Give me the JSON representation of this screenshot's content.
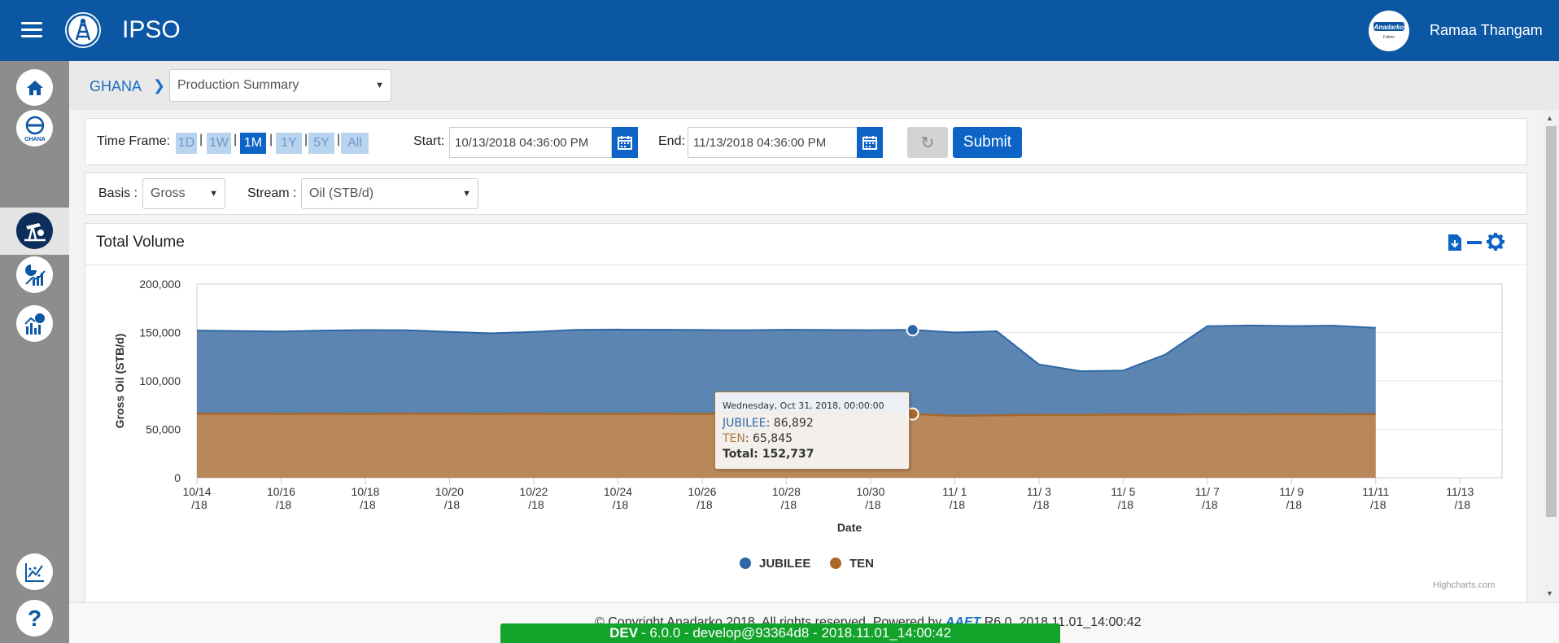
{
  "header": {
    "title": "IPSO",
    "user_name": "Ramaa Thangam",
    "menu_icon": "hamburger-menu-icon",
    "logo_icon": "oil-derrick-logo-icon",
    "avatar_label": "Anadarko",
    "avatar_sublabel": "Fabric"
  },
  "sidebar": {
    "items": [
      {
        "icon": "home-icon"
      },
      {
        "icon": "ghana-icon",
        "label": "GHANA"
      },
      {
        "icon": "pumpjack-icon"
      },
      {
        "icon": "analytics-icon"
      },
      {
        "icon": "reports-icon"
      },
      {
        "icon": "trend-icon"
      },
      {
        "icon": "help-icon",
        "label": "?"
      }
    ]
  },
  "breadcrumb": {
    "root": "GHANA",
    "separator": "❯",
    "page_select": "Production Summary"
  },
  "timeframe": {
    "label": "Time Frame:",
    "buttons": [
      "1D",
      "1W",
      "1M",
      "1Y",
      "5Y",
      "All"
    ],
    "active": "1M",
    "start_label": "Start:",
    "start_value": "10/13/2018 04:36:00 PM",
    "end_label": "End:",
    "end_value": "11/13/2018 04:36:00 PM",
    "submit_label": "Submit"
  },
  "filters": {
    "basis_label": "Basis :",
    "basis_value": "Gross",
    "stream_label": "Stream :",
    "stream_value": "Oil (STB/d)"
  },
  "chart_panel": {
    "title": "Total Volume",
    "credits": "Highcharts.com",
    "tooltip": {
      "date": "Wednesday, Oct 31, 2018, 00:00:00",
      "jubilee_label": "JUBILEE",
      "jubilee_value": "86,892",
      "ten_label": "TEN",
      "ten_value": "65,845",
      "total_label": "Total",
      "total_value": "152,737"
    }
  },
  "chart_data": {
    "type": "area",
    "stacked": true,
    "xlabel": "Date",
    "ylabel": "Gross Oil (STB/d)",
    "ylim": [
      0,
      200000
    ],
    "yticks": [
      "0",
      "50,000",
      "100,000",
      "150,000",
      "200,000"
    ],
    "xticks": [
      [
        "10/14",
        "/18"
      ],
      [
        "10/16",
        "/18"
      ],
      [
        "10/18",
        "/18"
      ],
      [
        "10/20",
        "/18"
      ],
      [
        "10/22",
        "/18"
      ],
      [
        "10/24",
        "/18"
      ],
      [
        "10/26",
        "/18"
      ],
      [
        "10/28",
        "/18"
      ],
      [
        "10/30",
        "/18"
      ],
      [
        "11/ 1",
        "/18"
      ],
      [
        "11/ 3",
        "/18"
      ],
      [
        "11/ 5",
        "/18"
      ],
      [
        "11/ 7",
        "/18"
      ],
      [
        "11/ 9",
        "/18"
      ],
      [
        "11/11",
        "/18"
      ],
      [
        "11/13",
        "/18"
      ]
    ],
    "x": [
      "10/14/18",
      "10/15/18",
      "10/16/18",
      "10/17/18",
      "10/18/18",
      "10/19/18",
      "10/20/18",
      "10/21/18",
      "10/22/18",
      "10/23/18",
      "10/24/18",
      "10/25/18",
      "10/26/18",
      "10/27/18",
      "10/28/18",
      "10/29/18",
      "10/30/18",
      "10/31/18",
      "11/1/18",
      "11/2/18",
      "11/3/18",
      "11/4/18",
      "11/5/18",
      "11/6/18",
      "11/7/18",
      "11/8/18",
      "11/9/18",
      "11/10/18",
      "11/11/18"
    ],
    "series": [
      {
        "name": "TEN",
        "color": "#b07a3d",
        "values": [
          66000,
          66200,
          66000,
          66100,
          66000,
          66200,
          66100,
          66000,
          66100,
          65900,
          66000,
          66100,
          65900,
          66000,
          65900,
          65900,
          65900,
          65845,
          64000,
          64500,
          65000,
          65000,
          65200,
          65200,
          65500,
          65400,
          65600,
          65500,
          65700
        ]
      },
      {
        "name": "JUBILEE",
        "color": "#2d66a5",
        "values": [
          86000,
          85300,
          85000,
          85900,
          86500,
          86100,
          84500,
          83200,
          84500,
          86800,
          87000,
          86700,
          86700,
          86300,
          86900,
          86700,
          86500,
          86892,
          86000,
          86800,
          52000,
          45000,
          45500,
          62000,
          91000,
          91800,
          91000,
          91500,
          89100
        ]
      }
    ],
    "legend": [
      "JUBILEE",
      "TEN"
    ],
    "legend_position": "bottom-center",
    "grid": true
  },
  "footer": {
    "copyright": "© Copyright Anadarko 2018, All rights reserved. Powered by",
    "powered_logo": "AAET",
    "version_text": "R6.0_2018.11.01_14:00:42",
    "dev_env": "DEV",
    "dev_text": "- 6.0.0 - develop@93364d8 - 2018.11.01_14:00:42"
  }
}
